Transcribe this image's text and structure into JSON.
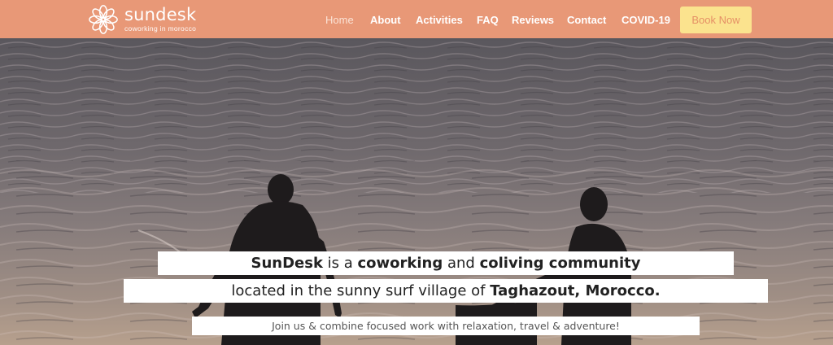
{
  "brand": {
    "name": "sundesk",
    "tagline": "coworking in morocco"
  },
  "nav": {
    "items": [
      {
        "label": "Home",
        "active": true
      },
      {
        "label": "About"
      },
      {
        "label": "Activities"
      },
      {
        "label": "FAQ"
      },
      {
        "label": "Reviews"
      },
      {
        "label": "Contact"
      },
      {
        "label": "COVID-19"
      }
    ],
    "book_label": "Book Now"
  },
  "hero": {
    "line1": {
      "brand": "SunDesk",
      "t1": " is a ",
      "b1": "coworking",
      "t2": " and ",
      "b2": "coliving community"
    },
    "line2": {
      "t1": "located in the sunny surf village of ",
      "b1": "Taghazout, Morocco."
    },
    "line3": "Join us & combine focused work with relaxation, travel & adventure!"
  },
  "colors": {
    "header_bg": "#e89877",
    "book_bg": "#fbe38e",
    "book_text": "#e59066"
  }
}
